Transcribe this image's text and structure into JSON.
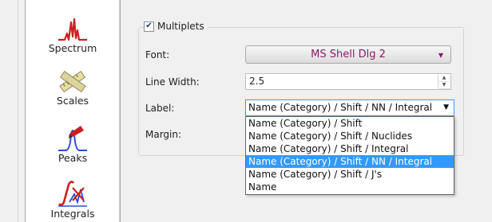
{
  "sidebar": {
    "items": [
      {
        "label": "Spectrum",
        "icon": "spectrum-icon"
      },
      {
        "label": "Scales",
        "icon": "ruler-icon"
      },
      {
        "label": "Peaks",
        "icon": "peaks-icon"
      },
      {
        "label": "Integrals",
        "icon": "integrals-icon"
      }
    ]
  },
  "multiplets": {
    "checkbox_label": "Multiplets",
    "checked": true,
    "font_label": "Font:",
    "font_value": "MS Shell Dlg 2",
    "line_width_label": "Line Width:",
    "line_width_value": "2.5",
    "label_label": "Label:",
    "label_value": "Name (Category) / Shift / NN / Integral",
    "margin_label": "Margin:"
  },
  "label_options": [
    "Name (Category) / Shift",
    "Name (Category) / Shift / Nuclides",
    "Name (Category) / Shift / Integral",
    "Name (Category) / Shift / NN / Integral",
    "Name (Category) / Shift / J's",
    "Name"
  ],
  "selected_option_index": 3,
  "colors": {
    "accent": "#3399ff",
    "font_text": "#8c1c6c",
    "icon_red": "#cc1f1f"
  }
}
